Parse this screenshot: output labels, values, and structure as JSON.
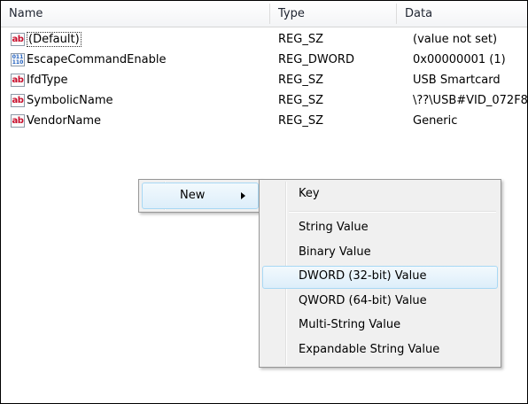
{
  "columns": {
    "name": "Name",
    "type": "Type",
    "data": "Data"
  },
  "rows": [
    {
      "icon": "string-value-icon",
      "icon_text": "ab",
      "name": "(Default)",
      "type": "REG_SZ",
      "data": "(value not set)"
    },
    {
      "icon": "binary-value-icon",
      "icon_text": "011\n110",
      "name": "EscapeCommandEnable",
      "type": "REG_DWORD",
      "data": "0x00000001 (1)"
    },
    {
      "icon": "string-value-icon",
      "icon_text": "ab",
      "name": "IfdType",
      "type": "REG_SZ",
      "data": "USB Smartcard"
    },
    {
      "icon": "string-value-icon",
      "icon_text": "ab",
      "name": "SymbolicName",
      "type": "REG_SZ",
      "data": "\\??\\USB#VID_072F8"
    },
    {
      "icon": "string-value-icon",
      "icon_text": "ab",
      "name": "VendorName",
      "type": "REG_SZ",
      "data": "Generic"
    }
  ],
  "context_menu": {
    "new_label": "New",
    "submenu": {
      "key": "Key",
      "string_value": "String Value",
      "binary_value": "Binary Value",
      "dword_value": "DWORD (32-bit) Value",
      "qword_value": "QWORD (64-bit) Value",
      "multi_string_value": "Multi-String Value",
      "expandable_string_value": "Expandable String Value"
    },
    "highlighted": "DWORD (32-bit) Value"
  }
}
